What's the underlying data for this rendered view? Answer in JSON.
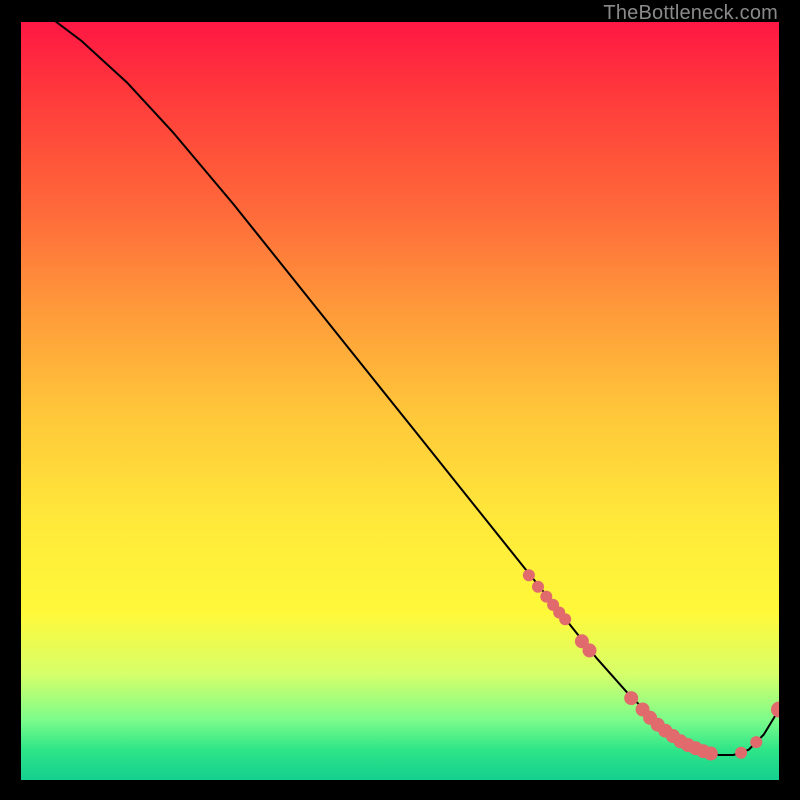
{
  "watermark": "TheBottleneck.com",
  "colors": {
    "dot": "#e06a6c",
    "curve": "#000000"
  },
  "chart_data": {
    "type": "line",
    "title": "",
    "xlabel": "",
    "ylabel": "",
    "xlim": [
      0,
      100
    ],
    "ylim": [
      0,
      100
    ],
    "grid": false,
    "series": [
      {
        "name": "bottleneck-curve",
        "x": [
          0,
          4,
          8,
          14,
          20,
          28,
          36,
          44,
          52,
          60,
          66,
          72,
          76,
          80,
          83,
          86,
          89,
          92,
          94,
          96,
          98,
          100
        ],
        "y": [
          103,
          100.5,
          97.5,
          92,
          85.5,
          76,
          66,
          56,
          46,
          36,
          28.5,
          21,
          16,
          11.5,
          8.5,
          6,
          4.3,
          3.3,
          3.3,
          4,
          6,
          9.3
        ]
      }
    ],
    "highlight_points": {
      "name": "highlighted-range",
      "x": [
        67,
        68.2,
        69.3,
        70.2,
        71,
        71.8,
        74,
        75,
        80.5,
        82,
        83,
        84,
        85,
        86,
        87,
        88,
        89,
        90,
        91,
        95,
        97,
        100
      ],
      "y": [
        27,
        25.5,
        24.2,
        23.1,
        22.1,
        21.2,
        18.3,
        17.1,
        10.8,
        9.3,
        8.2,
        7.3,
        6.5,
        5.8,
        5.1,
        4.6,
        4.2,
        3.8,
        3.5,
        3.6,
        5.0,
        9.3
      ],
      "radius": [
        6,
        6,
        6,
        6,
        6,
        6,
        7,
        7,
        7,
        7,
        7,
        7,
        7,
        7,
        7,
        7,
        7,
        7,
        7,
        6,
        6,
        8
      ]
    }
  }
}
